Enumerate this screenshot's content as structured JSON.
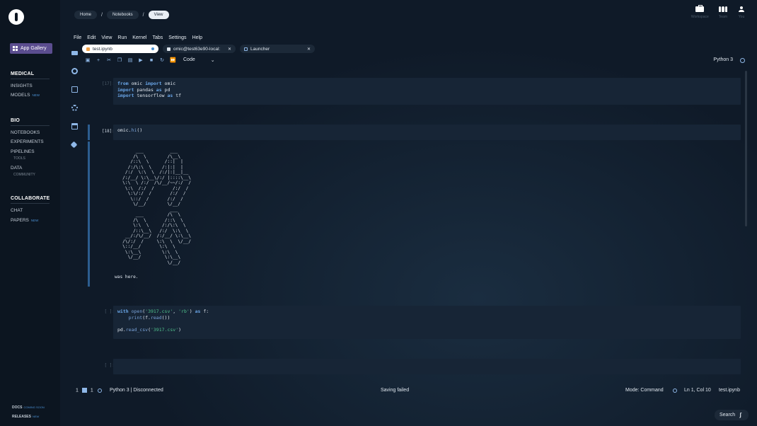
{
  "sidebar": {
    "app_gallery": "App Gallery",
    "sections": [
      {
        "title": "MEDICAL",
        "items": [
          {
            "label": "INSIGHTS",
            "tag": ""
          },
          {
            "label": "MODELS",
            "tag": "NEW"
          }
        ]
      },
      {
        "title": "BIO",
        "items": [
          {
            "label": "NOTEBOOKS",
            "tag": ""
          },
          {
            "label": "EXPERIMENTS",
            "tag": ""
          },
          {
            "label": "PIPELINES",
            "tag": ""
          },
          {
            "label": "DATA",
            "tag": ""
          }
        ],
        "subs": [
          "TOOLS",
          "COMMUNITY"
        ]
      },
      {
        "title": "COLLABORATE",
        "items": [
          {
            "label": "CHAT",
            "tag": ""
          },
          {
            "label": "PAPERS",
            "tag": "NEW"
          }
        ]
      }
    ],
    "footer": [
      {
        "label": "DOCS",
        "tag": "COMING SOON"
      },
      {
        "label": "RELEASES",
        "tag": "NEW"
      }
    ]
  },
  "breadcrumb": [
    "Home",
    "Notebooks",
    "View"
  ],
  "top_right": [
    {
      "label": "Workspace",
      "icon": "briefcase-icon"
    },
    {
      "label": "Team",
      "icon": "team-icon"
    },
    {
      "label": "You",
      "icon": "user-icon"
    }
  ],
  "menu": [
    "File",
    "Edit",
    "View",
    "Run",
    "Kernel",
    "Tabs",
    "Settings",
    "Help"
  ],
  "tabs": [
    {
      "label": "test.ipynb"
    },
    {
      "label": "omic@test63e90-local:"
    },
    {
      "label": "Launcher"
    }
  ],
  "toolbar": {
    "cell_type": "Code",
    "kernel": "Python 3"
  },
  "cells": {
    "c1": {
      "prompt": "[17]:",
      "lines": [
        "from omic import omic",
        "import pandas as pd",
        "import tensorflow as tf"
      ]
    },
    "c2": {
      "prompt": "[18]:",
      "code": "omic.hi()"
    },
    "c2_output": {
      "ascii": "        ___          ___\n       /\\  \\        /\\__\\\n      /::\\  \\      /::|  |\n     /:/\\:\\  \\    /:|:|  |\n    /:/  \\:\\  \\  /:/|:|__|__\n   /:/__/ \\:\\__\\/:/ |::::\\__\\\n   \\:\\  \\ /:/  /\\/__/~~/:/  /\n    \\:\\  /:/  /       /:/  /\n     \\:\\/:/  /       /:/  /\n      \\::/  /       /:/  /\n       \\/__/        \\/__/\n                     ___\n        ___         /\\  \\\n       /\\  \\       /::\\  \\\n       \\:\\  \\     /:/\\:\\  \\\n       /::\\__\\   /:/  \\:\\  \\\n    __/:/\\/__/  /:/__/ \\:\\__\\\n   /\\/:/  /     \\:\\  \\  \\/__/\n   \\::/__/       \\:\\  \\\n    \\:\\__\\        \\:\\  \\\n     \\/__/         \\:\\__\\\n                    \\/__/",
      "text": "was here."
    },
    "c3": {
      "prompt": "[ ]:",
      "lines": [
        "with open('3917.csv', 'rb') as f:",
        "    print(f.read())",
        "",
        "pd.read_csv('3917.csv')"
      ]
    },
    "c4": {
      "prompt": "[ ]:"
    }
  },
  "status": {
    "left_count1": "1",
    "left_count2": "1",
    "kernel_state": "Python 3 | Disconnected",
    "center": "Saving failed",
    "mode": "Mode: Command",
    "position": "Ln 1, Col 10",
    "file": "test.ipynb"
  },
  "search": {
    "label": "Search"
  }
}
